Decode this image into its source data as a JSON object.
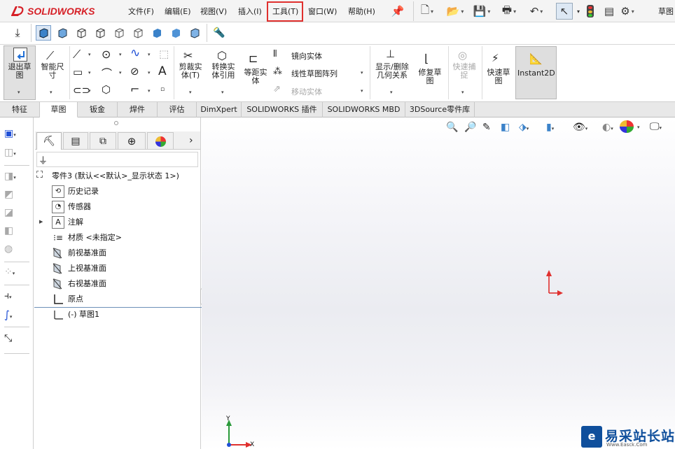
{
  "app": {
    "logo_text": "SOLIDWORKS"
  },
  "menus": [
    "文件(F)",
    "编辑(E)",
    "视图(V)",
    "插入(I)",
    "工具(T)",
    "窗口(W)",
    "帮助(H)"
  ],
  "title_right": "草图",
  "ribbon": {
    "exit_sketch": [
      "退出草",
      "图"
    ],
    "smart_dimension": [
      "智能尺",
      "寸"
    ],
    "trim": [
      "剪裁实",
      "体(T)"
    ],
    "convert": [
      "转换实",
      "体引用"
    ],
    "offset": [
      "等距实",
      "体"
    ],
    "mirror": "镜向实体",
    "linear_pattern": "线性草图阵列",
    "move": "移动实体",
    "display_delete": [
      "显示/删除",
      "几何关系"
    ],
    "repair": [
      "修复草",
      "图"
    ],
    "quick_snap": [
      "快速捕",
      "捉"
    ],
    "rapid_sketch": [
      "快速草",
      "图"
    ],
    "instant2d": "Instant2D"
  },
  "tabs": [
    "特征",
    "草图",
    "钣金",
    "焊件",
    "评估",
    "DimXpert",
    "SOLIDWORKS 插件",
    "SOLIDWORKS MBD",
    "3DSource零件库"
  ],
  "tree": {
    "root": "零件3 (默认<<默认>_显示状态 1>)",
    "items": [
      "历史记录",
      "传感器",
      "注解",
      "材质 <未指定>",
      "前视基准面",
      "上视基准面",
      "右视基准面",
      "原点",
      "(-) 草图1"
    ]
  },
  "triad": {
    "x": "X",
    "y": "Y"
  },
  "watermark": {
    "title": "易采站长站",
    "subtitle": "Www.Easck.Com"
  },
  "colors": {
    "accent_red": "#e0302e",
    "logo_red": "#d61f26",
    "axis_red": "#e0302e",
    "triad_green": "#2a9a3a",
    "triad_blue": "#1f4fd6"
  }
}
